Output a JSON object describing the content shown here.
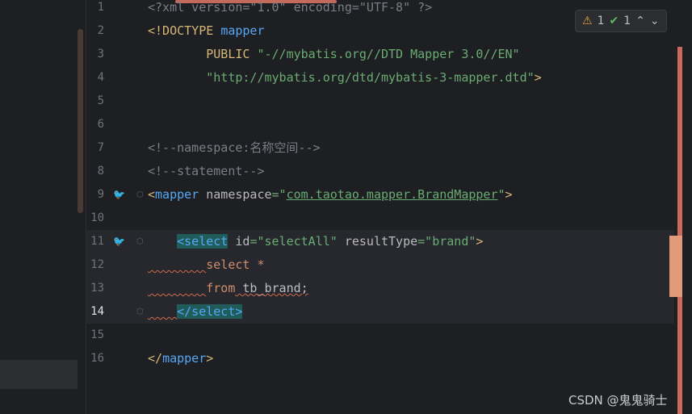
{
  "inspection": {
    "warnings": "1",
    "ok": "1"
  },
  "lines": [
    {
      "num": "1"
    },
    {
      "num": "2"
    },
    {
      "num": "3"
    },
    {
      "num": "4"
    },
    {
      "num": "5"
    },
    {
      "num": "6"
    },
    {
      "num": "7"
    },
    {
      "num": "8"
    },
    {
      "num": "9"
    },
    {
      "num": "10"
    },
    {
      "num": "11"
    },
    {
      "num": "12"
    },
    {
      "num": "13"
    },
    {
      "num": "14"
    },
    {
      "num": "15"
    },
    {
      "num": "16"
    }
  ],
  "code": {
    "l1": "<?xml version=\"1.0\" encoding=\"UTF-8\" ?>",
    "l2_a": "<!DOCTYPE ",
    "l2_b": "mapper",
    "l3_a": "        PUBLIC ",
    "l3_b": "\"-//mybatis.org//DTD Mapper 3.0//EN\"",
    "l4_a": "        ",
    "l4_b": "\"http://mybatis.org/dtd/mybatis-3-mapper.dtd\"",
    "l4_c": ">",
    "l7": "<!--namespace:名称空间-->",
    "l8": "<!--statement-->",
    "l9_a": "<",
    "l9_b": "mapper",
    "l9_c": " namespace",
    "l9_d": "=\"",
    "l9_e": "com.taotao.mapper.BrandMapper",
    "l9_f": "\"",
    "l9_g": ">",
    "l11_a": "    ",
    "l11_b": "<select",
    "l11_c": " id",
    "l11_d": "=\"selectAll\"",
    "l11_e": " resultType",
    "l11_f": "=\"brand\"",
    "l11_g": ">",
    "l12_a": "        ",
    "l12_b": "select",
    "l12_c": " *",
    "l13_a": "        ",
    "l13_b": "from",
    "l13_c": " tb_brand;",
    "l14_a": "    ",
    "l14_b": "</select>",
    "l16_a": "</",
    "l16_b": "mapper",
    "l16_c": ">"
  },
  "watermark": "CSDN @鬼鬼骑士"
}
